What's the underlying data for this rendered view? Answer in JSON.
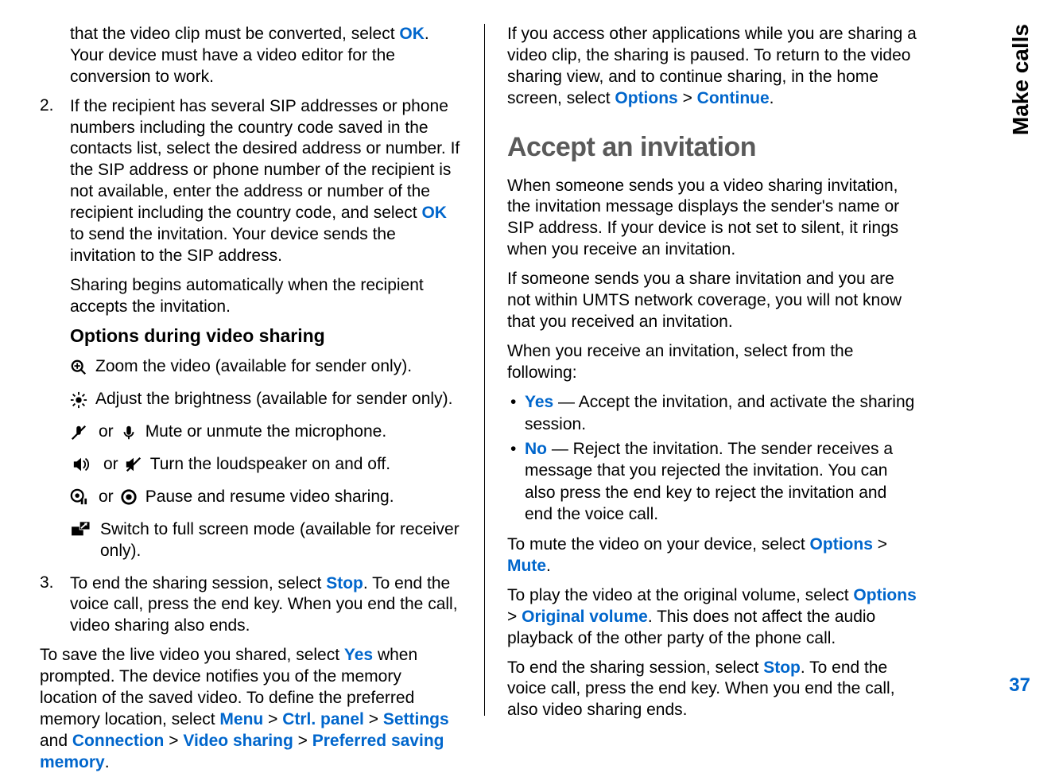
{
  "sideLabel": "Make calls",
  "pageNumber": "37",
  "left": {
    "p1a": "that the video clip must be converted, select ",
    "p1_ok": "OK",
    "p1b": ". Your device must have a video editor for the conversion to work.",
    "num2": "2.",
    "p2a": "If the recipient has several SIP addresses or phone numbers including the country code saved in the contacts list, select the desired address or number. If the SIP address or phone number of the recipient is not available, enter the address or number of the recipient including the country code, and select ",
    "p2_ok": "OK",
    "p2b": " to send the invitation. Your device sends the invitation to the SIP address.",
    "p3": "Sharing begins automatically when the recipient accepts the invitation.",
    "h3": "Options during video sharing",
    "opt_zoom": "Zoom the video (available for sender only).",
    "opt_bright": "Adjust the brightness (available for sender only).",
    "opt_mute_or": "or",
    "opt_mute": "Mute or unmute the microphone.",
    "opt_speaker_or": "or",
    "opt_speaker": "Turn the loudspeaker on and off.",
    "opt_pause_or": "or",
    "opt_pause": "Pause and resume video sharing.",
    "opt_full": "Switch to full screen mode (available for receiver only).",
    "num3": "3.",
    "p4a": "To end the sharing session, select ",
    "p4_stop": "Stop",
    "p4b": ". To end the voice call, press the end key. When you end the call, video sharing also ends.",
    "p5a": "To save the live video you shared, select ",
    "p5_yes": "Yes",
    "p5b": " when prompted. The device notifies you of the memory location of the saved video. To define the preferred memory location, select ",
    "p5_menu": "Menu",
    "gt": " > ",
    "p5_ctrl": "Ctrl. panel",
    "p5_settings": "Settings",
    "p5_and": " and ",
    "p5_conn": "Connection",
    "p5_vs": "Video sharing",
    "p5_pref": "Preferred saving memory",
    "dot": "."
  },
  "right": {
    "r1a": "If you access other applications while you are sharing a video clip, the sharing is paused. To return to the video sharing view, and to continue sharing, in the home screen, select ",
    "r1_opt": "Options",
    "gt": " > ",
    "r1_cont": "Continue",
    "dot": ".",
    "h2": "Accept an invitation",
    "r2": "When someone sends you a video sharing invitation, the invitation message displays the sender's name or SIP address. If your device is not set to silent, it rings when you receive an invitation.",
    "r3": "If someone sends you a share invitation and you are not within UMTS network coverage, you will not know that you received an invitation.",
    "r4": "When you receive an invitation, select from the following:",
    "b_yes": "Yes",
    "b_yes_txt": " — Accept the invitation, and activate the sharing session.",
    "b_no": "No",
    "b_no_txt": " — Reject the invitation. The sender receives a message that you rejected the invitation. You can also press the end key to reject the invitation and end the voice call.",
    "r5a": "To mute the video on your device, select ",
    "r5_opt": "Options",
    "r5_mute": "Mute",
    "r6a": "To play the video at the original volume, select ",
    "r6_opt": "Options",
    "r6_ov": "Original volume",
    "r6b": ". This does not affect the audio playback of the other party of the phone call.",
    "r7a": "To end the sharing session, select ",
    "r7_stop": "Stop",
    "r7b": ". To end the voice call, press the end key. When you end the call, also video sharing ends."
  }
}
